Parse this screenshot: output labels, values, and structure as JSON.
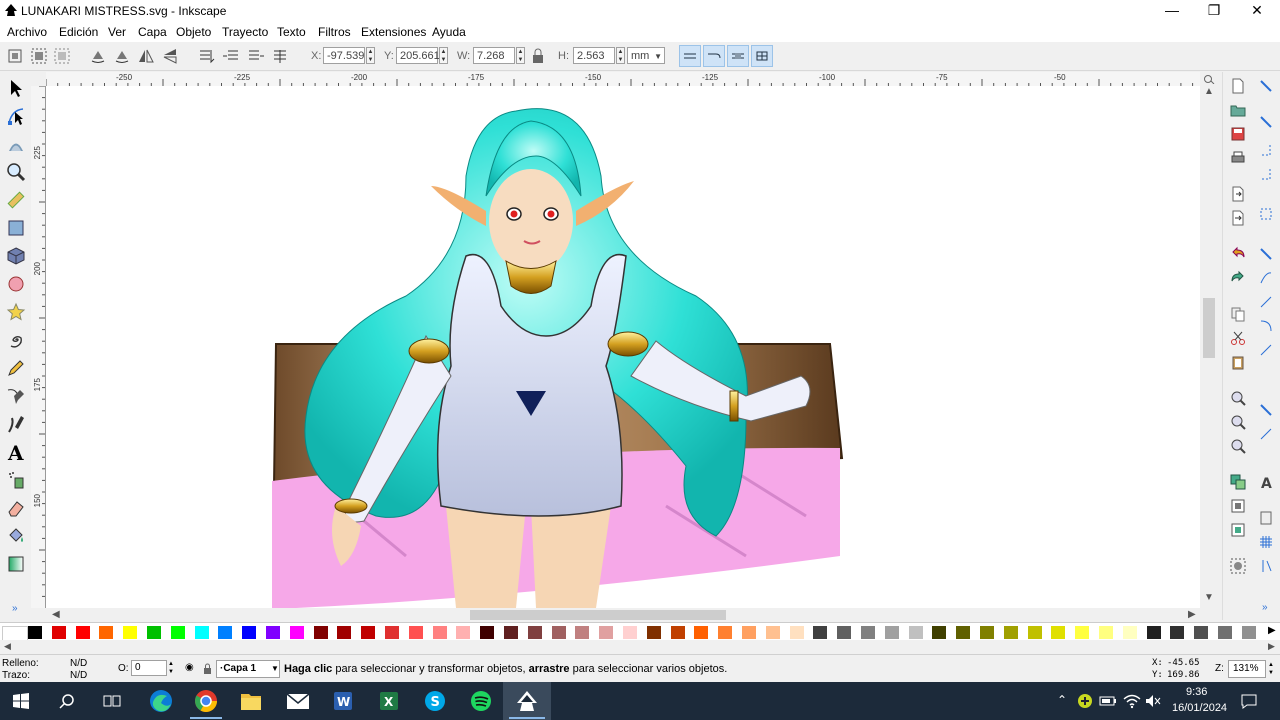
{
  "window": {
    "title": "LUNAKARI MISTRESS.svg - Inkscape",
    "minimize_glyph": "—",
    "maximize_glyph": "❐",
    "close_glyph": "✕"
  },
  "menu": [
    "Archivo",
    "Edición",
    "Ver",
    "Capa",
    "Objeto",
    "Trayecto",
    "Texto",
    "Filtros",
    "Extensiones",
    "Ayuda"
  ],
  "toolbar": {
    "x_label": "X:",
    "x_value": "-97.539",
    "y_label": "Y:",
    "y_value": "205.661",
    "w_label": "W:",
    "w_value": "7.268",
    "h_label": "H:",
    "h_value": "2.563",
    "unit": "mm"
  },
  "ruler": {
    "h_labels": [
      "-250",
      "-225",
      "-200",
      "-175",
      "-150",
      "-125",
      "-100",
      "-75",
      "-50"
    ],
    "v_labels": [
      "225",
      "200",
      "175",
      "150"
    ]
  },
  "status": {
    "fill_label": "Relleno:",
    "fill_value": "N/D",
    "stroke_label": "Trazo:",
    "stroke_value": "N/D",
    "opacity_label": "O:",
    "opacity_value": "0",
    "layer": "·Capa 1",
    "message_bold1": "Haga clic",
    "message_part1": " para seleccionar y transformar objetos, ",
    "message_bold2": "arrastre",
    "message_part2": " para seleccionar varios objetos.",
    "x_coord_label": "X:",
    "x_coord": "-45.65",
    "y_coord_label": "Y:",
    "y_coord": "169.86",
    "zoom_label": "Z:",
    "zoom": "131%"
  },
  "taskbar": {
    "time": "9:36",
    "date": "16/01/2024"
  },
  "palette_colors": [
    "#000000",
    "#e00000",
    "#ff0000",
    "#ff6600",
    "#ffff00",
    "#00c000",
    "#00ff00",
    "#00ffff",
    "#0080ff",
    "#0000ff",
    "#8000ff",
    "#ff00ff",
    "#800000",
    "#a00000",
    "#c00000",
    "#e03030",
    "#ff5050",
    "#ff8080",
    "#ffb0b0",
    "#400000",
    "#602020",
    "#804040",
    "#a06060",
    "#c08080",
    "#e0a0a0",
    "#ffd0d0",
    "#803000",
    "#c04000",
    "#ff6000",
    "#ff8030",
    "#ffa060",
    "#ffc090",
    "#ffe0c0",
    "#404040",
    "#606060",
    "#808080",
    "#a0a0a0",
    "#c0c0c0",
    "#404000",
    "#606000",
    "#808000",
    "#a0a000",
    "#c0c000",
    "#e0e000",
    "#ffff40",
    "#ffff80",
    "#ffffc0",
    "#202020",
    "#303030",
    "#505050",
    "#707070",
    "#909090"
  ]
}
